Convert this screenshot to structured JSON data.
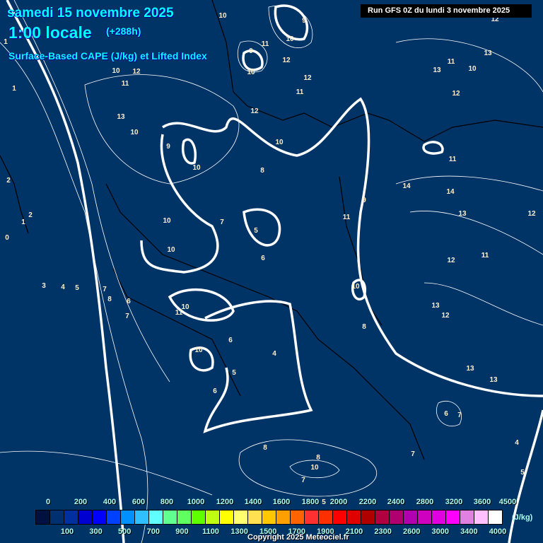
{
  "header": {
    "date": "samedi 15 novembre 2025",
    "time": "1:00 locale",
    "offset": "(+288h)",
    "parameter": "Surface-Based CAPE (J/kg) et Lifted Index",
    "run": "Run GFS 0Z du lundi 3 novembre 2025"
  },
  "legend": {
    "unit": "(J/kg)",
    "top_labels": [
      "0",
      "200",
      "400",
      "600",
      "800",
      "1000",
      "1200",
      "1400",
      "1600",
      "1800",
      "2000",
      "2200",
      "2400",
      "2800",
      "3200",
      "3600",
      "4500"
    ],
    "bottom_labels": [
      "100",
      "300",
      "500",
      "700",
      "900",
      "1100",
      "1300",
      "1500",
      "1700",
      "1900",
      "2100",
      "2300",
      "2600",
      "3000",
      "3400",
      "4000"
    ],
    "colors": [
      "#001040",
      "#003070",
      "#0030a0",
      "#0000d0",
      "#0000ff",
      "#0040ff",
      "#0090ff",
      "#30c0ff",
      "#60ffff",
      "#60ff90",
      "#60ff60",
      "#60ff00",
      "#c0ff10",
      "#ffff00",
      "#ffff70",
      "#ffe050",
      "#ffc800",
      "#ffa000",
      "#ff6400",
      "#ff3030",
      "#ff3000",
      "#ff0000",
      "#e00000",
      "#b00000",
      "#b00040",
      "#b00070",
      "#b000b0",
      "#d000c0",
      "#e000e0",
      "#ff00ff",
      "#e080e0",
      "#ffc0ff",
      "#ffffff"
    ]
  },
  "contour_labels": [
    "10",
    "9",
    "10",
    "11",
    "9",
    "12",
    "10",
    "12",
    "12",
    "11",
    "13",
    "10",
    "11",
    "12",
    "12",
    "10",
    "13",
    "11",
    "12",
    "13",
    "10",
    "9",
    "10",
    "8",
    "10",
    "11",
    "14",
    "14",
    "13",
    "12",
    "11",
    "5",
    "7",
    "10",
    "6",
    "10",
    "12",
    "11",
    "9",
    "11",
    "13",
    "12",
    "10",
    "7",
    "8",
    "6",
    "7",
    "10",
    "11",
    "6",
    "10",
    "5",
    "4",
    "8",
    "6",
    "13",
    "13",
    "6",
    "7",
    "4",
    "8",
    "10",
    "8",
    "7",
    "5",
    "7",
    "3",
    "4",
    "5",
    "2",
    "2",
    "1",
    "1",
    "0",
    "1",
    "5"
  ],
  "copyright": "Copyright 2025 Meteociel.fr"
}
